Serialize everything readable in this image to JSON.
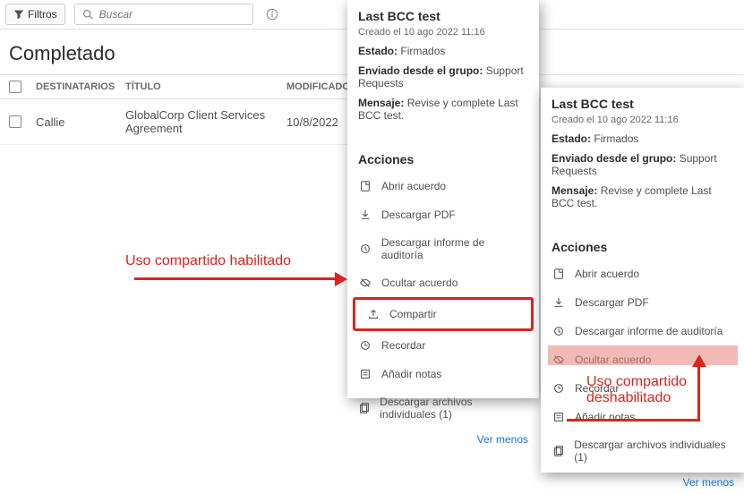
{
  "topbar": {
    "filters_label": "Filtros",
    "search_placeholder": "Buscar"
  },
  "page_title": "Completado",
  "table": {
    "headers": {
      "destinatarios": "DESTINATARIOS",
      "titulo": "TÍTULO",
      "modificado": "MODIFICADO"
    },
    "rows": [
      {
        "dest": "Callie",
        "titulo": "GlobalCorp Client Services Agreement",
        "mod": "10/8/2022"
      }
    ]
  },
  "panel1": {
    "title": "Last BCC test",
    "created": "Creado el 10 ago 2022 11:16",
    "estado_label": "Estado:",
    "estado_val": "Firmados",
    "grupo_label": "Enviado desde el grupo:",
    "grupo_val": "Support Requests",
    "mensaje_label": "Mensaje:",
    "mensaje_val": "Revise y complete Last BCC test.",
    "section_title": "Acciones",
    "actions": {
      "abrir": "Abrir acuerdo",
      "descargar_pdf": "Descargar PDF",
      "descargar_informe": "Descargar informe de auditoría",
      "ocultar": "Ocultar acuerdo",
      "compartir": "Compartir",
      "recordar": "Recordar",
      "notas": "Añadir notas",
      "descargar_ind": "Descargar archivos individuales (1)"
    },
    "ver_menos": "Ver menos"
  },
  "panel2": {
    "title": "Last BCC test",
    "created": "Creado el 10 ago 2022 11:16",
    "estado_label": "Estado:",
    "estado_val": "Firmados",
    "grupo_label": "Enviado desde el grupo:",
    "grupo_val": "Support Requests",
    "mensaje_label": "Mensaje:",
    "mensaje_val": "Revise y complete Last BCC test.",
    "section_title": "Acciones",
    "actions": {
      "abrir": "Abrir acuerdo",
      "descargar_pdf": "Descargar PDF",
      "descargar_informe": "Descargar informe de auditoría",
      "ocultar": "Ocultar acuerdo",
      "recordar": "Recordar",
      "notas": "Añadir notas",
      "descargar_ind": "Descargar archivos individuales (1)"
    },
    "ver_menos": "Ver menos"
  },
  "annotations": {
    "enabled": "Uso compartido habilitado",
    "disabled_l1": "Uso compartido",
    "disabled_l2": "deshabilitado"
  },
  "colors": {
    "red": "#d9251c",
    "link": "#1473e6"
  }
}
